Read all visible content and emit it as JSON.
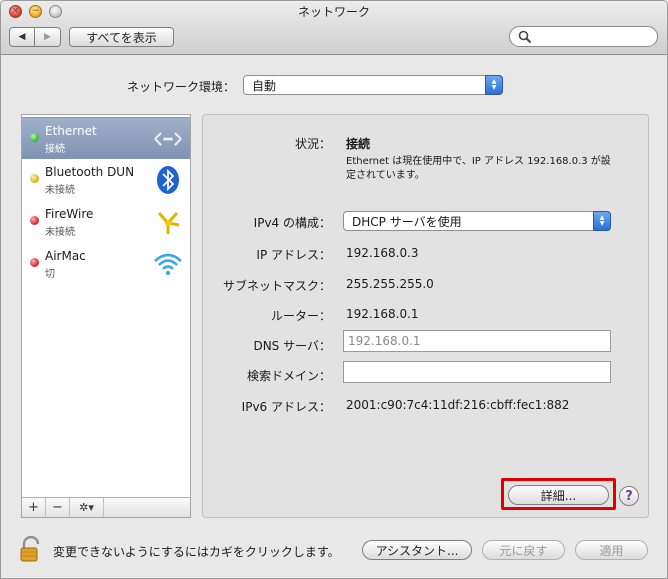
{
  "window": {
    "title": "ネットワーク"
  },
  "toolbar": {
    "back_label": "◀",
    "forward_label": "▶",
    "show_all_label": "すべてを表示",
    "search_value": ""
  },
  "location": {
    "label": "ネットワーク環境：",
    "value": "自動"
  },
  "sidebar": {
    "items": [
      {
        "name": "Ethernet",
        "state": "接続",
        "status_color": "#3fbf3f",
        "icon": "ethernet-icon"
      },
      {
        "name": "Bluetooth DUN",
        "state": "未接続",
        "status_color": "#e6b422",
        "icon": "bluetooth-icon"
      },
      {
        "name": "FireWire",
        "state": "未接続",
        "status_color": "#d93030",
        "icon": "firewire-icon"
      },
      {
        "name": "AirMac",
        "state": "切",
        "status_color": "#d93030",
        "icon": "airmac-icon"
      }
    ],
    "footer": {
      "add": "+",
      "remove": "−",
      "action": "✲▾"
    }
  },
  "detail": {
    "status_label": "状況：",
    "status_value": "接続",
    "status_description": "Ethernet は現在使用中で、IP アドレス 192.168.0.3 が設定されています。",
    "config_label": "IPv4 の構成：",
    "config_value": "DHCP サーバを使用",
    "ip_label": "IP アドレス：",
    "ip_value": "192.168.0.3",
    "subnet_label": "サブネットマスク：",
    "subnet_value": "255.255.255.0",
    "router_label": "ルーター：",
    "router_value": "192.168.0.1",
    "dns_label": "DNS サーバ：",
    "dns_value": "192.168.0.1",
    "search_domain_label": "検索ドメイン：",
    "search_domain_value": "",
    "ipv6_label": "IPv6 アドレス：",
    "ipv6_value": "2001:c90:7c4:11df:216:cbff:fec1:882",
    "advanced_button": "詳細...",
    "help_button": "?"
  },
  "bottom": {
    "lock_text": "変更できないようにするにはカギをクリックします。",
    "assistant_button": "アシスタント...",
    "revert_button": "元に戻す",
    "apply_button": "適用"
  },
  "colors": {
    "accent": "#2c6fd5",
    "selection": "#8a9dbb",
    "highlight": "#e00000"
  }
}
